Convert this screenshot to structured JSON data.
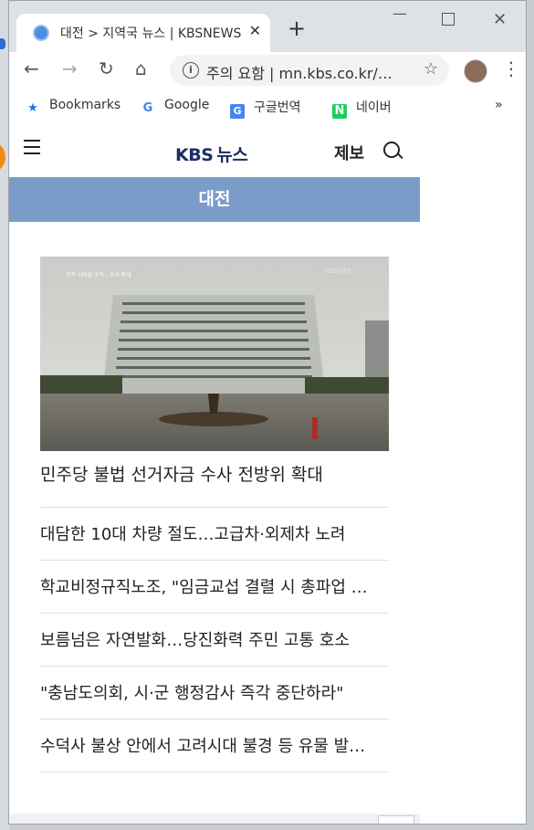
{
  "browser": {
    "tab_title": "대전 > 지역국 뉴스 | KBSNEWS",
    "new_tab": "+",
    "url_security": "주의 요함",
    "url_text": "mn.kbs.co.kr/…",
    "window_controls": {
      "minimize": "—",
      "maximize": "",
      "close": "✕"
    },
    "bookmarks": [
      {
        "label": "Bookmarks",
        "icon": "star-icon"
      },
      {
        "label": "Google",
        "icon": "google-icon"
      },
      {
        "label": "구글번역",
        "icon": "translate-icon"
      },
      {
        "label": "네이버",
        "icon": "naver-icon"
      }
    ],
    "bookmarks_more": "»"
  },
  "site": {
    "logo_kbs": "KBS",
    "logo_news": "뉴스",
    "report_label": "제보",
    "region_title": "대전",
    "hero_caption": "민주당 불법 선거자금 수사 전방위 확대",
    "hero_overlay": "전직 시의원 구속…수사 확대",
    "hero_watermark": "KBS 대전",
    "articles": [
      "대담한 10대 차량 절도…고급차·외제차 노려",
      "학교비정규직노조, \"임금교섭 결렬 시 총파업 …",
      "보름넘은 자연발화…당진화력 주민 고통 호소",
      "\"충남도의회, 시·군 행정감사 즉각 중단하라\"",
      "수덕사 불상 안에서 고려시대 불경 등 유물 발…"
    ]
  },
  "colors": {
    "region_bar": "#7b9cc8",
    "logo": "#1c2d63",
    "titlebar": "#dee1e6"
  }
}
